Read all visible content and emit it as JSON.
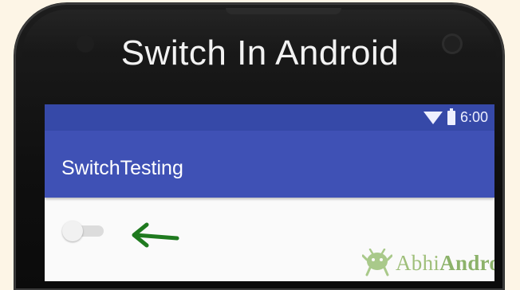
{
  "headline": "Switch In Android",
  "status_bar": {
    "time": "6:00",
    "wifi_icon": "wifi-icon",
    "battery_icon": "battery-icon",
    "color": "#3649a8"
  },
  "app_bar": {
    "title": "SwitchTesting",
    "color": "#3f51b5"
  },
  "switch": {
    "state": "off"
  },
  "annotation": {
    "arrow_color": "#1f7a1f",
    "arrow_icon": "left-arrow-icon"
  },
  "watermark": {
    "text_main": "Abhi",
    "text_accent": "Android",
    "icon": "android-bug-icon"
  }
}
